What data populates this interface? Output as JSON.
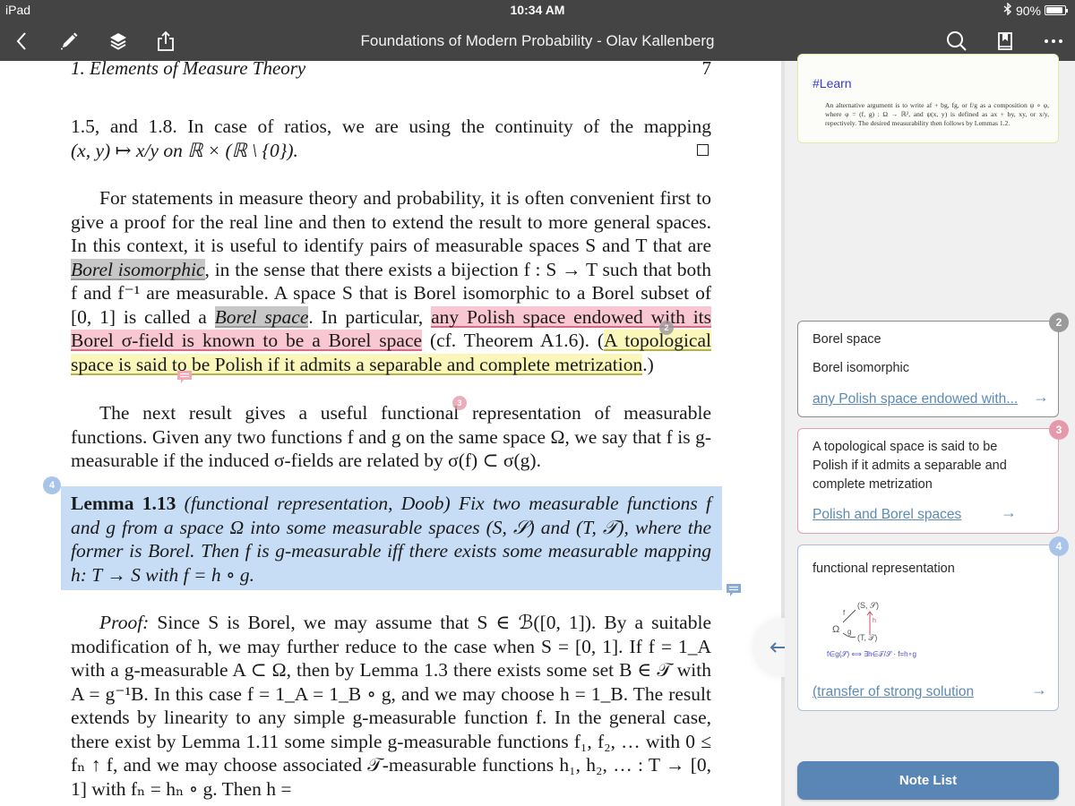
{
  "status_bar": {
    "device": "iPad",
    "time": "10:34 AM",
    "bluetooth_icon": "bluetooth-icon",
    "battery_percent_label": "90%",
    "battery_level": 0.9
  },
  "toolbar": {
    "title": "Foundations of Modern Probability - Olav Kallenberg",
    "left_icons": [
      "back-chevron-icon",
      "pencil-icon",
      "layers-icon",
      "share-icon"
    ],
    "right_icons": [
      "search-icon",
      "bookmark-icon",
      "more-icon"
    ]
  },
  "document": {
    "running_head": "1. Elements of Measure Theory",
    "page_number": "7",
    "para1": {
      "l1": "1.5, and 1.8. In case of ratios, we are using the continuity of the mapping",
      "l2": "(x, y) ↦ x/y on ℝ × (ℝ \\ {0})."
    },
    "para2": {
      "a": "For statements in measure theory and probability, it is often convenient first to give a proof for the real line and then to extend the result to more general spaces. In this context, it is useful to identify pairs of measurable spaces S and T that are ",
      "hl1": "Borel isomorphic",
      "b": ", in the sense that there exists a bijection f : S → T such that both f and f⁻¹ are measurable. A space S that is Borel isomorphic to a Borel subset of [0, 1] is called a ",
      "hl2": "Borel space",
      "c": ". In particular, ",
      "hl3": "any Polish space endowed with its Borel σ-field is known to be a Borel space",
      "d": " (cf. Theorem A1.6). (",
      "hl4": "A topological space is said to be Polish if it admits a separable and complete metrization",
      "e": ".)"
    },
    "para3": "The next result gives a useful functional representation of measurable functions. Given any two functions f and g on the same space Ω, we say that f is g-measurable if the induced σ-fields are related by σ(f) ⊂ σ(g).",
    "lemma": {
      "label": "Lemma 1.13",
      "body": " (functional representation, Doob)  Fix two measurable functions f and g from a space Ω into some measurable spaces (S, 𝒮) and (T, 𝒯), where the former is Borel. Then f is g-measurable iff there exists some measurable mapping h: T → S with f = h ∘ g."
    },
    "proof": {
      "label": "Proof:",
      "body": " Since S is Borel, we may assume that S ∈ ℬ([0, 1]). By a suitable modification of h, we may further reduce to the case when S = [0, 1]. If f = 1_A with a g-measurable A ⊂ Ω, then by Lemma 1.3 there exists some set B ∈ 𝒯 with A = g⁻¹B. In this case f = 1_A = 1_B ∘ g, and we may choose h = 1_B. The result extends by linearity to any simple g-measurable function f. In the general case, there exist by Lemma 1.11 some simple g-measurable functions f₁, f₂, … with 0 ≤ fₙ ↑ f, and we may choose associated 𝒯-measurable functions h₁, h₂, … : T → [0, 1] with fₙ = hₙ ∘ g. Then h ="
    },
    "markers": {
      "m2": "2",
      "m3": "3",
      "m4": "4"
    }
  },
  "sidebar": {
    "learn_card": {
      "tag": "#Learn",
      "snippet": "An alternative argument is to write af + bg, fg, or f/g as a composition ψ ∘ φ, where φ = (f, g) : Ω → ℝ², and ψ(x, y) is defined as ax + by, xy, or x/y, repectively. The desired measurability then follows by Lemmas 1.2."
    },
    "cards": [
      {
        "badge": "2",
        "lines": [
          "Borel space",
          "Borel isomorphic"
        ],
        "link": "any Polish space endowed with...",
        "color": "#8d8d8d"
      },
      {
        "badge": "3",
        "text": "A topological space is said to be Polish if it admits a separable and complete metrization",
        "link": "Polish and Borel spaces",
        "color": "#e3a2b1"
      },
      {
        "badge": "4",
        "title": "functional representation",
        "sketch": {
          "labels": [
            "(S, 𝒮)",
            "Ω",
            "(T, 𝒯)",
            "f",
            "g",
            "h"
          ],
          "caption": "f∈g(𝒮) ⟺ ∃h∈𝒯/𝒮 · f=h∘g"
        },
        "link": "(transfer of strong solution",
        "color": "#a9bfdc"
      }
    ],
    "note_list_label": "Note List"
  },
  "colors": {
    "toolbar_bg": "#444444",
    "highlight_gray": "#c7c7c7",
    "highlight_pink": "#f9c7d2",
    "highlight_yellow": "#fbf6b9",
    "highlight_blue": "#c7ddf6",
    "accent_blue": "#5a86b5"
  }
}
